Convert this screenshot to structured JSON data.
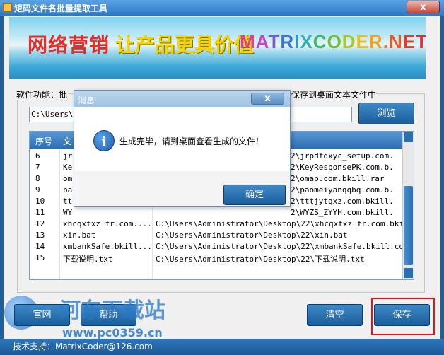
{
  "window": {
    "title": "矩码文件名批量提取工具",
    "close_label": "x"
  },
  "banner": {
    "text_cn1": "网络营销",
    "text_cn2": "让产品更具价值",
    "text_en": "MATRIXCODER.NET",
    "letters_en": [
      {
        "ch": "M",
        "color": "#e63a8c"
      },
      {
        "ch": "A",
        "color": "#c24ac9"
      },
      {
        "ch": "T",
        "color": "#7a58d8"
      },
      {
        "ch": "R",
        "color": "#3a77d9"
      },
      {
        "ch": "I",
        "color": "#2a95cf"
      },
      {
        "ch": "X",
        "color": "#2ab3b3"
      },
      {
        "ch": "C",
        "color": "#39b86b"
      },
      {
        "ch": "O",
        "color": "#6cc23a"
      },
      {
        "ch": "D",
        "color": "#a8c92a"
      },
      {
        "ch": "E",
        "color": "#e0c11f"
      },
      {
        "ch": "R",
        "color": "#f0a21a"
      },
      {
        "ch": ".",
        "color": "#ee7c1c"
      },
      {
        "ch": "N",
        "color": "#e85a22"
      },
      {
        "ch": "E",
        "color": "#e23c2a"
      },
      {
        "ch": "T",
        "color": "#d92f3a"
      }
    ]
  },
  "main": {
    "feature_desc_left": "软件功能：批",
    "feature_desc_right": "保存到桌面文本文件中",
    "path_value": "C:\\Users\\A",
    "browse_label": "浏览"
  },
  "list": {
    "headers": [
      "序号",
      "文"
    ],
    "rows": [
      {
        "num": "6",
        "name": "jr",
        "path": "2\\jrpdfqxyc_setup.com."
      },
      {
        "num": "7",
        "name": "Ke",
        "path": "2\\KeyResponsePK.com.b."
      },
      {
        "num": "8",
        "name": "om",
        "path": "2\\omap.com.bkill.rar"
      },
      {
        "num": "9",
        "name": "pa",
        "path": "2\\paomeiyanqqbq.com.b."
      },
      {
        "num": "10",
        "name": "tt",
        "path": "2\\tttjytqxz.com.bkill."
      },
      {
        "num": "11",
        "name": "WY",
        "path": "2\\WYZS_ZYYH.com.bkill."
      },
      {
        "num": "12",
        "name": "xhcqxtxz_fr.com....",
        "path": "C:\\Users\\Administrator\\Desktop\\22\\xhcqxtxz_fr.com.bki."
      },
      {
        "num": "13",
        "name": "xin.bat",
        "path": "C:\\Users\\Administrator\\Desktop\\22\\xin.bat"
      },
      {
        "num": "14",
        "name": "xmbankSafe.bkill...",
        "path": "C:\\Users\\Administrator\\Desktop\\22\\xmbankSafe.bkill.co."
      },
      {
        "num": "15",
        "name": "下载说明.txt",
        "path": "C:\\Users\\Administrator\\Desktop\\22\\下载说明.txt"
      }
    ]
  },
  "dialog": {
    "title": "消息",
    "close_label": "x",
    "icon": "info-icon",
    "icon_glyph": "i",
    "message": "生成完毕，请到桌面查看生成的文件！",
    "ok_label": "确定"
  },
  "footer": {
    "site_label": "官网",
    "help_label": "帮助",
    "clear_label": "清空",
    "save_label": "保存",
    "status_text": "技术支持：MatrixCoder@126.com"
  },
  "watermark": {
    "text1": "河东下载站",
    "text2": "www.pc0359.cn"
  },
  "colors": {
    "highlight": "#e0161c",
    "accent": "#2b6fb3"
  }
}
